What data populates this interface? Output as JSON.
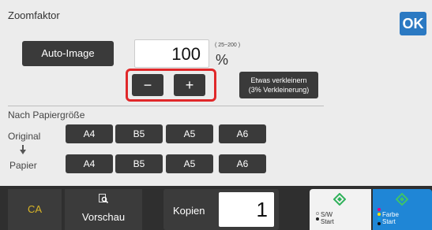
{
  "header": {
    "title": "Zoomfaktor",
    "ok_label": "OK"
  },
  "zoom": {
    "auto_image_label": "Auto-Image",
    "value": "100",
    "range_hint": "( 25~200 )",
    "unit": "%",
    "minus_label": "−",
    "plus_label": "+",
    "shrink_line1": "Etwas verkleinern",
    "shrink_line2": "(3% Verkleinerung)"
  },
  "paper": {
    "section_title": "Nach Papiergröße",
    "original_label": "Original",
    "papier_label": "Papier",
    "original_sizes": [
      "A4",
      "B5",
      "A5",
      "A6"
    ],
    "paper_sizes": [
      "A4",
      "B5",
      "A5",
      "A6"
    ]
  },
  "bottom": {
    "ca_label": "CA",
    "preview_label": "Vorschau",
    "copies_label": "Kopien",
    "copies_value": "1",
    "bw_start_line1": "S/W",
    "bw_start_line2": "Start",
    "color_start_line1": "Farbe",
    "color_start_line2": "Start"
  },
  "colors": {
    "accent_blue": "#2b79c2",
    "highlight_red": "#e0282a",
    "ca_yellow": "#d8b427",
    "start_green": "#2fb15a",
    "color_start_blue": "#1f86d6"
  },
  "icons": {
    "preview": "magnifier-page-icon",
    "start": "diamond-start-icon",
    "arrow": "arrow-down-icon"
  }
}
